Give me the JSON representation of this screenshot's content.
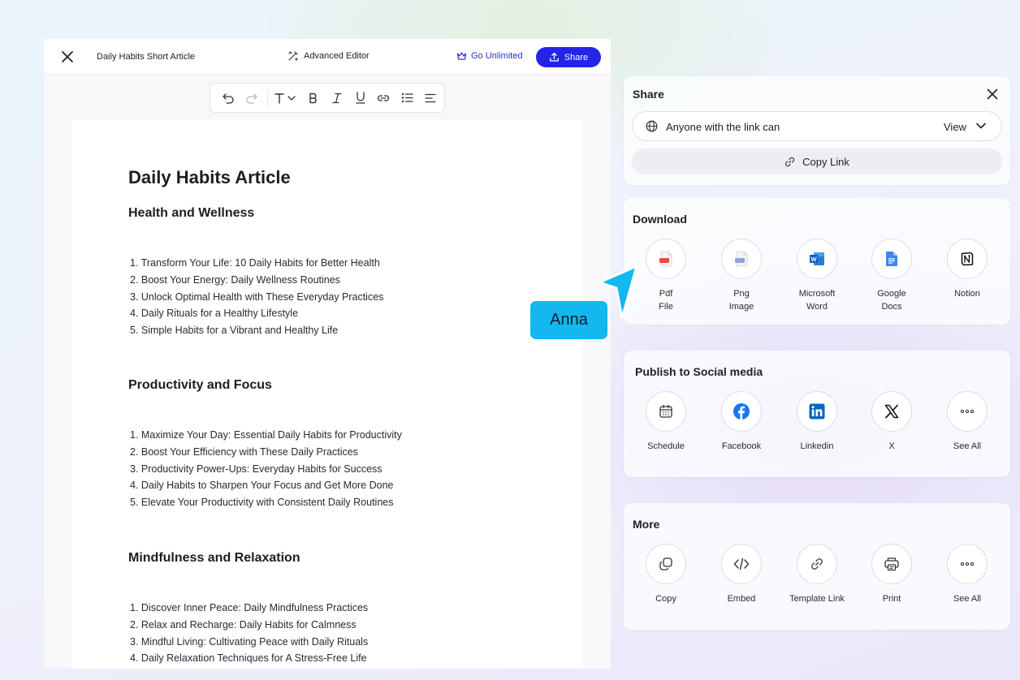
{
  "editor": {
    "doc_title": "Daily Habits Short Article",
    "advanced_editor": "Advanced Editor",
    "go_unlimited": "Go Unlimited",
    "share": "Share",
    "accent": "#2424e8"
  },
  "article": {
    "title": "Daily Habits Article",
    "sections": [
      {
        "heading": "Health and Wellness",
        "items": [
          "1. Transform Your Life: 10 Daily Habits for Better Health",
          "2. Boost Your Energy: Daily Wellness Routines",
          "3. Unlock Optimal Health with These Everyday Practices",
          "4. Daily Rituals for a Healthy Lifestyle",
          "5. Simple Habits for a Vibrant and Healthy Life"
        ]
      },
      {
        "heading": "Productivity and Focus",
        "items": [
          "1. Maximize Your Day: Essential Daily Habits for Productivity",
          "2. Boost Your Efficiency with These Daily Practices",
          "3. Productivity Power-Ups: Everyday Habits for Success",
          "4. Daily Habits to Sharpen Your Focus and Get More Done",
          "5. Elevate Your Productivity with Consistent Daily Routines"
        ]
      },
      {
        "heading": "Mindfulness and Relaxation",
        "items": [
          "1. Discover Inner Peace: Daily Mindfulness Practices",
          "2. Relax and Recharge: Daily Habits for Calmness",
          "3. Mindful Living: Cultivating Peace with Daily Rituals",
          "4. Daily Relaxation Techniques for A Stress-Free Life"
        ]
      }
    ]
  },
  "share_panel": {
    "title": "Share",
    "access_label": "Anyone with the link can",
    "access_value": "View",
    "copy_link": "Copy Link"
  },
  "download": {
    "title": "Download",
    "items": [
      {
        "line1": "Pdf",
        "line2": "File"
      },
      {
        "line1": "Png",
        "line2": "Image"
      },
      {
        "line1": "Microsoft",
        "line2": "Word"
      },
      {
        "line1": "Google",
        "line2": "Docs"
      },
      {
        "line1": "Notion",
        "line2": ""
      }
    ]
  },
  "social": {
    "title": "Publish to Social media",
    "items": [
      "Schedule",
      "Facebook",
      "Linkedin",
      "X",
      "See All"
    ],
    "colors": {
      "facebook": "#1877f2",
      "linkedin": "#0a66c2"
    }
  },
  "more": {
    "title": "More",
    "items": [
      "Copy",
      "Embed",
      "Template Link",
      "Print",
      "See All"
    ]
  },
  "cursor": {
    "name": "Anna",
    "color": "#12b8ee"
  }
}
